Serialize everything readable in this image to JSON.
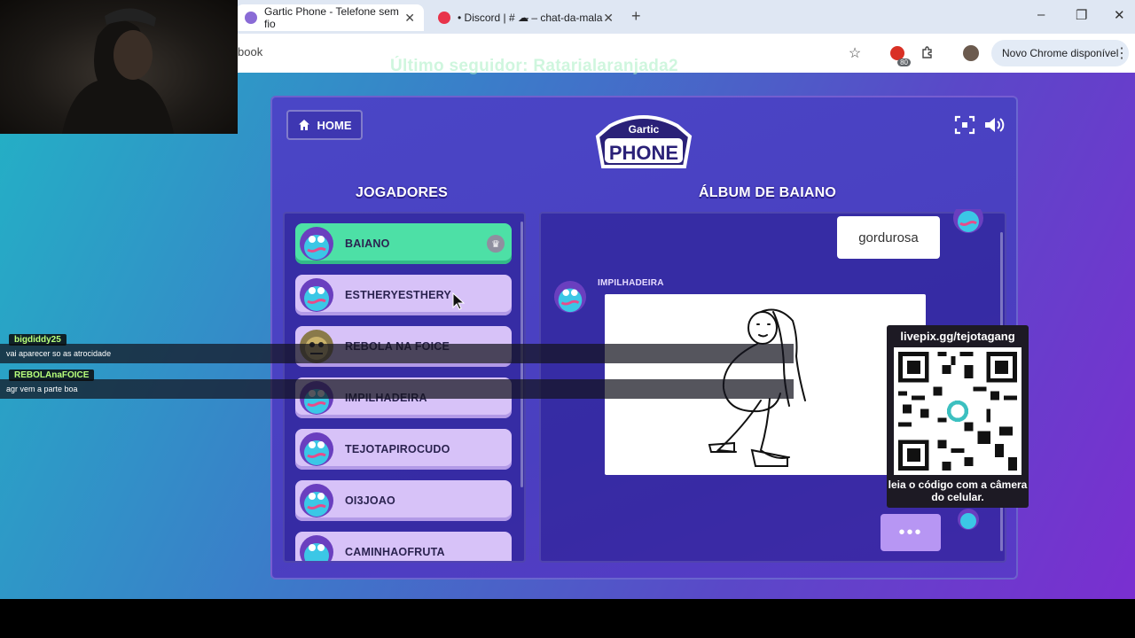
{
  "browser": {
    "tabs": [
      {
        "title": "Gartic Phone - Telefone sem fio",
        "active": true
      },
      {
        "title": "• Discord | # ☁̶ – chat-da-mala",
        "active": false
      }
    ],
    "address_partial": "book",
    "update_label": "Novo Chrome disponível",
    "extension_badge": "80"
  },
  "stream": {
    "last_follower": "Último seguidor: Ratarialaranjada2",
    "chat": [
      {
        "user": "bigdiddy25",
        "message": "vai aparecer so as atrocidade"
      },
      {
        "user": "REBOLAnaFOICE",
        "message": "agr vem a parte boa"
      }
    ],
    "qr": {
      "url": "livepix.gg/tejotagang",
      "caption": "leia o código com a câmera do celular."
    }
  },
  "game": {
    "home_label": "HOME",
    "logo_text": {
      "top": "Gartic",
      "main": "PHONE"
    },
    "players_title": "JOGADORES",
    "album_title": "ÁLBUM DE BAIANO",
    "players": [
      {
        "name": "BAIANO",
        "host": true
      },
      {
        "name": "ESTHERYESTHERY"
      },
      {
        "name": "REBOLA NA FOICE"
      },
      {
        "name": "IMPILHADEIRA"
      },
      {
        "name": "TEJOTAPIROCUDO"
      },
      {
        "name": "OI3JOAO"
      },
      {
        "name": "CAMINHAOFRUTA"
      }
    ],
    "album": {
      "phrase": "gordurosa",
      "drawer": "IMPILHADEIRA",
      "more_label": "•••"
    }
  },
  "colors": {
    "accent_green": "#4de0a6",
    "player_card": "#d7c2f8",
    "chat_username": "#b8ff7a"
  }
}
